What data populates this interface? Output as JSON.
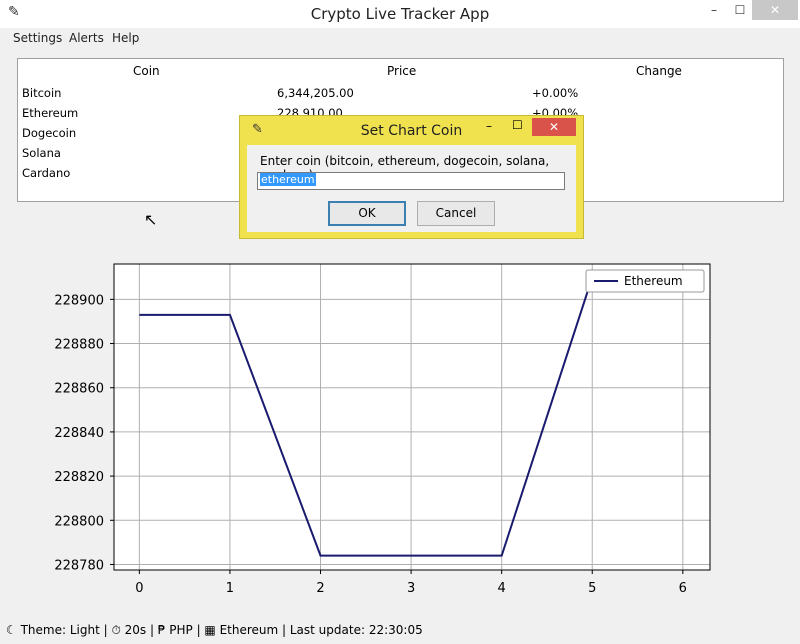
{
  "window": {
    "title": "Crypto Live Tracker App",
    "min_glyph": "–",
    "max_glyph": "☐",
    "close_glyph": "✕"
  },
  "menu": {
    "settings": "Settings",
    "alerts": "Alerts",
    "help": "Help"
  },
  "table": {
    "headers": {
      "coin": "Coin",
      "price": "Price",
      "change": "Change"
    },
    "rows": [
      {
        "coin": "Bitcoin",
        "price": "6,344,205.00",
        "change": "+0.00%"
      },
      {
        "coin": "Ethereum",
        "price": "228,910.00",
        "change": "+0.00%"
      },
      {
        "coin": "Dogecoin",
        "price": "",
        "change": ""
      },
      {
        "coin": "Solana",
        "price": "",
        "change": ""
      },
      {
        "coin": "Cardano",
        "price": "",
        "change": ""
      }
    ]
  },
  "dialog": {
    "title": "Set Chart Coin",
    "prompt": "Enter coin (bitcoin, ethereum, dogecoin, solana, cardano):",
    "input_value": "ethereum",
    "ok_label": "OK",
    "cancel_label": "Cancel",
    "close_glyph": "✕",
    "min_glyph": "–",
    "max_glyph": "☐"
  },
  "chart_data": {
    "type": "line",
    "x": [
      0,
      1,
      2,
      3,
      4,
      5,
      6
    ],
    "series": [
      {
        "name": "Ethereum",
        "values": [
          228893,
          228893,
          228784,
          228784,
          228784,
          228910,
          228910
        ],
        "color": "#1a1a6e"
      }
    ],
    "xticks": [
      0,
      1,
      2,
      3,
      4,
      5,
      6
    ],
    "yticks": [
      228780,
      228800,
      228820,
      228840,
      228860,
      228880,
      228900
    ],
    "xlim": [
      -0.28,
      6.3
    ],
    "ylim": [
      228777.5,
      228916
    ],
    "grid": true,
    "legend_position": "top-right"
  },
  "status": {
    "text": "☾ Theme: Light | ⏱ 20s | ₱ PHP | ▦ Ethereum | Last update: 22:30:05"
  }
}
